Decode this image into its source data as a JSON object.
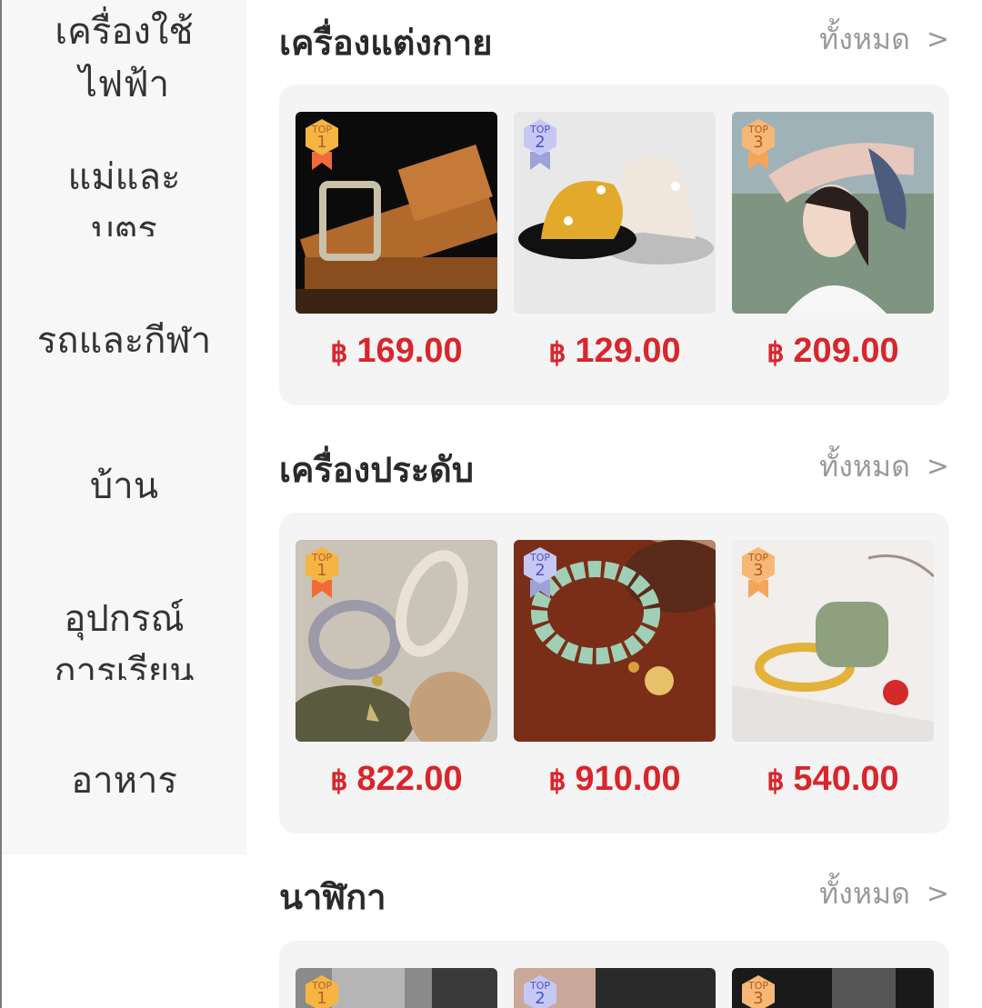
{
  "sidebar": {
    "items": [
      {
        "line1": "เครื่องใช้",
        "line2": "ไฟฟ้า"
      },
      {
        "line1": "แม่และ",
        "line2": "บุตร"
      },
      {
        "line1": "รถและกีฬา",
        "line2": ""
      },
      {
        "line1": "บ้าน",
        "line2": ""
      },
      {
        "line1": "อุปกรณ์",
        "line2": "การเรียน"
      },
      {
        "line1": "อาหาร",
        "line2": ""
      }
    ]
  },
  "sections": [
    {
      "title": "เครื่องแต่งกาย",
      "see_all": "ทั้งหมด",
      "products": [
        {
          "rank_label": "TOP",
          "rank": "1",
          "currency": "฿",
          "price": "169.00",
          "image": "leather-belt"
        },
        {
          "rank_label": "TOP",
          "rank": "2",
          "currency": "฿",
          "price": "129.00",
          "image": "bucket-hats"
        },
        {
          "rank_label": "TOP",
          "rank": "3",
          "currency": "฿",
          "price": "209.00",
          "image": "sun-visor-hat"
        }
      ]
    },
    {
      "title": "เครื่องประดับ",
      "see_all": "ทั้งหมด",
      "products": [
        {
          "rank_label": "TOP",
          "rank": "1",
          "currency": "฿",
          "price": "822.00",
          "image": "pearl-bracelets"
        },
        {
          "rank_label": "TOP",
          "rank": "2",
          "currency": "฿",
          "price": "910.00",
          "image": "jade-bead-bracelet"
        },
        {
          "rank_label": "TOP",
          "rank": "3",
          "currency": "฿",
          "price": "540.00",
          "image": "jade-gold-ring"
        }
      ]
    },
    {
      "title": "นาฬิกา",
      "see_all": "ทั้งหมด",
      "products": [
        {
          "rank_label": "TOP",
          "rank": "1",
          "image": "steel-watch"
        },
        {
          "rank_label": "TOP",
          "rank": "2",
          "image": "watch-on-wrist"
        },
        {
          "rank_label": "TOP",
          "rank": "3",
          "image": "black-watch"
        }
      ]
    }
  ],
  "colors": {
    "price": "#d8262c",
    "top1": "#f6b443",
    "top2": "#8a8fe8",
    "top3": "#f5a04a"
  }
}
